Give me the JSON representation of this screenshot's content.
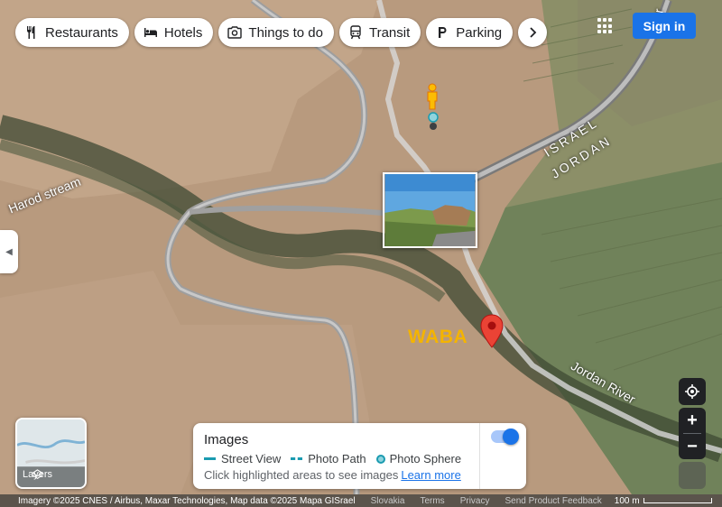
{
  "chips": [
    {
      "icon": "fork-knife-icon",
      "label": "Restaurants"
    },
    {
      "icon": "bed-icon",
      "label": "Hotels"
    },
    {
      "icon": "camera-icon",
      "label": "Things to do"
    },
    {
      "icon": "train-icon",
      "label": "Transit"
    },
    {
      "icon": "parking-icon",
      "label": "Parking"
    }
  ],
  "header": {
    "sign_in": "Sign in",
    "apps_icon": "apps-grid-icon"
  },
  "map_labels": {
    "stream": "Harod stream",
    "israel": "ISRAEL",
    "jordan": "JORDAN",
    "river": "Jordan River",
    "road_fragment": "er",
    "pin_label": "WABA"
  },
  "layers": {
    "label": "Layers"
  },
  "images_panel": {
    "title": "Images",
    "street_view": "Street View",
    "photo_path": "Photo Path",
    "photo_sphere": "Photo Sphere",
    "hint": "Click highlighted areas to see images",
    "learn_more": "Learn more",
    "toggle_on": true
  },
  "footer": {
    "attribution": "Imagery ©2025 CNES / Airbus, Maxar Technologies, Map data ©2025 Mapa GISrael",
    "region": "Slovakia",
    "terms": "Terms",
    "privacy": "Privacy",
    "feedback": "Send Product Feedback",
    "scale": "100 m"
  },
  "colors": {
    "accent": "#1a73e8",
    "pin": "#ea4335",
    "waba": "#f4b400",
    "street_view_line": "#1a9bb0"
  }
}
